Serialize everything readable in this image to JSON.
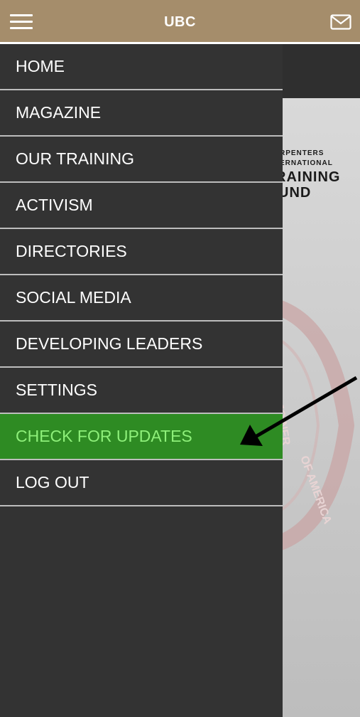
{
  "app": {
    "title": "UBC"
  },
  "header": {
    "menu_icon": "hamburger-menu-icon",
    "mail_icon": "mail-envelope-icon"
  },
  "poster": {
    "line1": "RPENTERS",
    "line2": "ERNATIONAL",
    "line3": "RAINING",
    "line4": "UND",
    "seal_text": [
      "JOINER",
      "OF AMERICA"
    ]
  },
  "menu": {
    "items": [
      {
        "label": "HOME"
      },
      {
        "label": "MAGAZINE"
      },
      {
        "label": "OUR TRAINING"
      },
      {
        "label": "ACTIVISM"
      },
      {
        "label": "DIRECTORIES"
      },
      {
        "label": "SOCIAL MEDIA"
      },
      {
        "label": "DEVELOPING LEADERS"
      },
      {
        "label": "SETTINGS"
      },
      {
        "label": "CHECK FOR UPDATES"
      },
      {
        "label": "LOG OUT"
      }
    ],
    "highlighted_index": 8
  },
  "colors": {
    "header": "#a58d6b",
    "drawer": "#333333",
    "highlight_bg": "#2e8b23",
    "highlight_text": "#8ef07a"
  }
}
